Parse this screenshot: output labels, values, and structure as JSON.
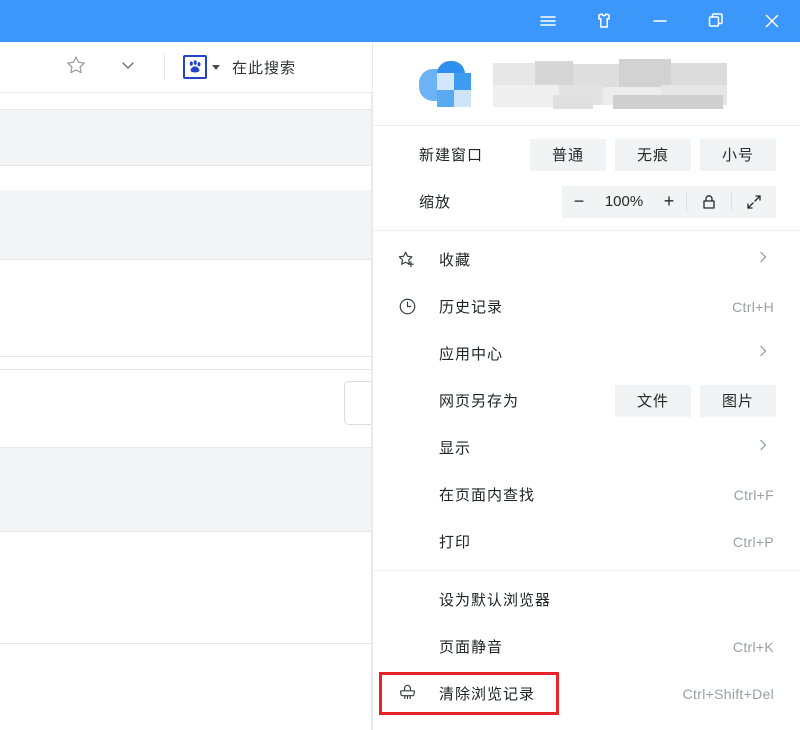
{
  "titlebar": {
    "buttons": [
      {
        "name": "menu-icon",
        "label": "☰"
      },
      {
        "name": "skin-icon",
        "label": "skin"
      },
      {
        "name": "minimize-icon",
        "label": "–"
      },
      {
        "name": "restore-icon",
        "label": "restore"
      },
      {
        "name": "close-icon",
        "label": "✕"
      }
    ]
  },
  "toolbar": {
    "star_icon": "star-icon",
    "chevron_icon": "chevron-down-icon",
    "engine_icon": "baidu-paw-icon",
    "search_hint": "在此搜索"
  },
  "menu": {
    "profile": {
      "avatar": "user-avatar",
      "username": ""
    },
    "new_window": {
      "label": "新建窗口",
      "options": [
        "普通",
        "无痕",
        "小号"
      ]
    },
    "zoom": {
      "label": "缩放",
      "minus": "−",
      "value": "100%",
      "plus": "+",
      "lock_icon": "lock-icon",
      "fullscreen_icon": "fullscreen-icon"
    },
    "items": [
      {
        "icon": "star-plus-icon",
        "label": "收藏",
        "shortcut": "",
        "arrow": true
      },
      {
        "icon": "clock-icon",
        "label": "历史记录",
        "shortcut": "Ctrl+H",
        "arrow": false
      },
      {
        "icon": "",
        "label": "应用中心",
        "shortcut": "",
        "arrow": true
      },
      {
        "icon": "",
        "label": "网页另存为",
        "shortcut": "",
        "arrow": false,
        "chips": [
          "文件",
          "图片"
        ]
      },
      {
        "icon": "",
        "label": "显示",
        "shortcut": "",
        "arrow": true
      },
      {
        "icon": "",
        "label": "在页面内查找",
        "shortcut": "Ctrl+F",
        "arrow": false
      },
      {
        "icon": "",
        "label": "打印",
        "shortcut": "Ctrl+P",
        "arrow": false
      }
    ],
    "items_bottom": [
      {
        "icon": "",
        "label": "设为默认浏览器",
        "shortcut": "",
        "arrow": false,
        "highlight": false
      },
      {
        "icon": "",
        "label": "页面静音",
        "shortcut": "Ctrl+K",
        "arrow": false,
        "highlight": false
      },
      {
        "icon": "broom-icon",
        "label": "清除浏览记录",
        "shortcut": "Ctrl+Shift+Del",
        "arrow": false,
        "highlight": true
      }
    ]
  },
  "colors": {
    "titlebar_blue": "#3b97fa",
    "highlight_red": "#e8232a",
    "chip_bg": "#f2f3f5",
    "text": "#222426",
    "muted": "#9b9fa3"
  }
}
